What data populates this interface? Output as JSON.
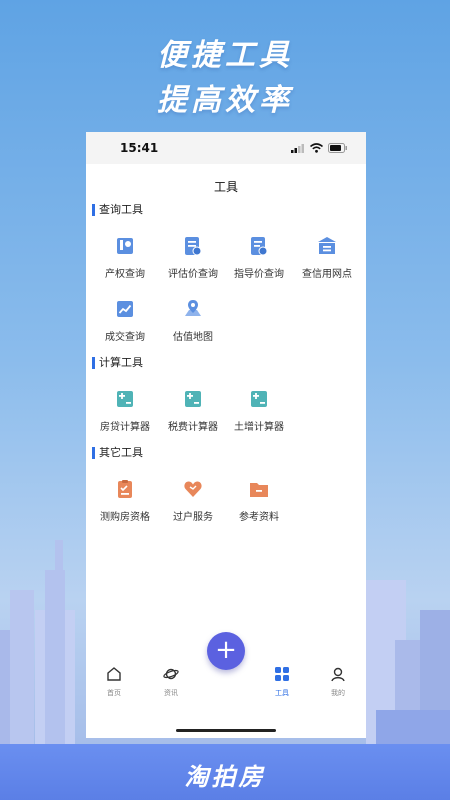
{
  "promo": {
    "line1": "便捷工具",
    "line2": "提高效率",
    "brand": "淘拍房"
  },
  "status_bar": {
    "time": "15:41"
  },
  "page": {
    "title": "工具"
  },
  "sections": [
    {
      "title": "查询工具",
      "tools": [
        {
          "label": "产权查询",
          "icon": "property-rights-icon"
        },
        {
          "label": "评估价查询",
          "icon": "appraisal-icon"
        },
        {
          "label": "指导价查询",
          "icon": "guide-price-icon"
        },
        {
          "label": "查信用网点",
          "icon": "bank-icon"
        },
        {
          "label": "成交查询",
          "icon": "trend-chart-icon"
        },
        {
          "label": "估值地图",
          "icon": "map-pin-icon"
        }
      ]
    },
    {
      "title": "计算工具",
      "tools": [
        {
          "label": "房贷计算器",
          "icon": "calculator-icon"
        },
        {
          "label": "税费计算器",
          "icon": "calculator-icon"
        },
        {
          "label": "土增计算器",
          "icon": "calculator-icon"
        }
      ]
    },
    {
      "title": "其它工具",
      "tools": [
        {
          "label": "测购房资格",
          "icon": "checklist-icon"
        },
        {
          "label": "过户服务",
          "icon": "heart-icon"
        },
        {
          "label": "参考资料",
          "icon": "folder-icon"
        }
      ]
    }
  ],
  "tabs": [
    {
      "label": "首页",
      "icon": "home-icon",
      "active": false
    },
    {
      "label": "资讯",
      "icon": "planet-icon",
      "active": false
    },
    {
      "label": "工具",
      "icon": "grid-icon",
      "active": true
    },
    {
      "label": "我的",
      "icon": "user-icon",
      "active": false
    }
  ],
  "colors": {
    "accent": "#2f6fe4",
    "teal": "#4fb3b6",
    "blue_icon": "#5b8fe0",
    "orange": "#e8875a",
    "fab": "#5b61e0"
  }
}
